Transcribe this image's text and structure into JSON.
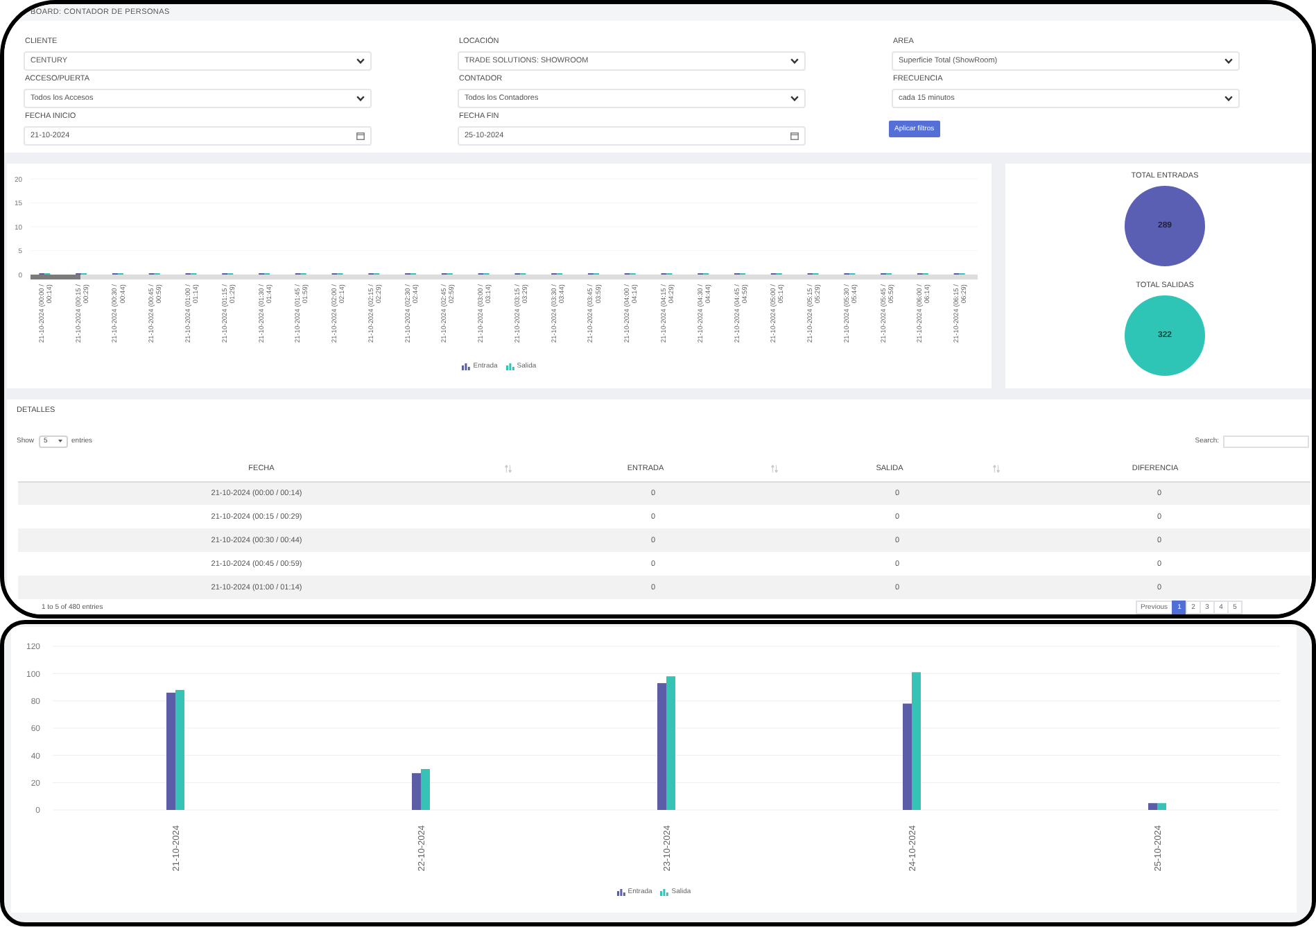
{
  "header": {
    "title": "BOARD: CONTADOR DE PERSONAS"
  },
  "filters": [
    {
      "label": "CLIENTE",
      "value": "CENTURY",
      "kind": "select"
    },
    {
      "label": "LOCACIÓN",
      "value": "TRADE SOLUTIONS: SHOWROOM",
      "kind": "select"
    },
    {
      "label": "AREA",
      "value": "Superficie Total (ShowRoom)",
      "kind": "select"
    },
    {
      "label": "ACCESO/PUERTA",
      "value": "Todos los Accesos",
      "kind": "select"
    },
    {
      "label": "CONTADOR",
      "value": "Todos los Contadores",
      "kind": "select"
    },
    {
      "label": "FRECUENCIA",
      "value": "cada 15 minutos",
      "kind": "select"
    },
    {
      "label": "FECHA INICIO",
      "value": "21-10-2024",
      "kind": "date"
    },
    {
      "label": "FECHA FIN",
      "value": "25-10-2024",
      "kind": "date"
    }
  ],
  "apply_button": "Aplicar filtros",
  "interval_chart": {
    "chart_data": {
      "type": "bar",
      "categories": [
        "21-10-2024 (00:00 / 00:14)",
        "21-10-2024 (00:15 / 00:29)",
        "21-10-2024 (00:30 / 00:44)",
        "21-10-2024 (00:45 / 00:59)",
        "21-10-2024 (01:00 / 01:14)",
        "21-10-2024 (01:15 / 01:29)",
        "21-10-2024 (01:30 / 01:44)",
        "21-10-2024 (01:45 / 01:59)",
        "21-10-2024 (02:00 / 02:14)",
        "21-10-2024 (02:15 / 02:29)",
        "21-10-2024 (02:30 / 02:44)",
        "21-10-2024 (02:45 / 02:59)",
        "21-10-2024 (03:00 / 03:14)",
        "21-10-2024 (03:15 / 03:29)",
        "21-10-2024 (03:30 / 03:44)",
        "21-10-2024 (03:45 / 03:59)",
        "21-10-2024 (04:00 / 04:14)",
        "21-10-2024 (04:15 / 04:29)",
        "21-10-2024 (04:30 / 04:44)",
        "21-10-2024 (04:45 / 04:59)",
        "21-10-2024 (05:00 / 05:14)",
        "21-10-2024 (05:15 / 05:29)",
        "21-10-2024 (05:30 / 05:44)",
        "21-10-2024 (05:45 / 05:59)",
        "21-10-2024 (06:00 / 06:14)",
        "21-10-2024 (06:15 / 06:29)"
      ],
      "series": [
        {
          "name": "Entrada",
          "color": "#5b5ea6",
          "values": [
            0,
            0,
            0,
            0,
            0,
            0,
            0,
            0,
            0,
            0,
            0,
            0,
            0,
            0,
            0,
            0,
            0,
            0,
            0,
            0,
            0,
            0,
            0,
            0,
            0,
            0
          ]
        },
        {
          "name": "Salida",
          "color": "#2ec4b6",
          "values": [
            0,
            0,
            0,
            0,
            0,
            0,
            0,
            0,
            0,
            0,
            0,
            0,
            0,
            0,
            0,
            0,
            0,
            0,
            0,
            0,
            0,
            0,
            0,
            0,
            0,
            0
          ]
        }
      ],
      "ylim": [
        0,
        20
      ],
      "yticks": [
        0,
        5,
        10,
        15,
        20
      ],
      "grid": true
    }
  },
  "totals": [
    {
      "label": "TOTAL ENTRADAS",
      "value": "289",
      "color": "#5b5fb4"
    },
    {
      "label": "TOTAL SALIDAS",
      "value": "322",
      "color": "#2ec4b6"
    }
  ],
  "details": {
    "title": "DETALLES",
    "show_label": "Show",
    "page_size": "5",
    "entries_label": "entries",
    "search_label": "Search:",
    "columns": [
      {
        "label": "FECHA",
        "sort_icon": true
      },
      {
        "label": "ENTRADA",
        "sort_icon": true
      },
      {
        "label": "SALIDA",
        "sort_icon": true
      },
      {
        "label": "DIFERENCIA",
        "sort_icon": false
      }
    ],
    "rows": [
      [
        "21-10-2024 (00:00 / 00:14)",
        "0",
        "0",
        "0"
      ],
      [
        "21-10-2024 (00:15 / 00:29)",
        "0",
        "0",
        "0"
      ],
      [
        "21-10-2024 (00:30 / 00:44)",
        "0",
        "0",
        "0"
      ],
      [
        "21-10-2024 (00:45 / 00:59)",
        "0",
        "0",
        "0"
      ],
      [
        "21-10-2024 (01:00 / 01:14)",
        "0",
        "0",
        "0"
      ]
    ],
    "info": "1 to 5 of 480 entries",
    "pagination": [
      {
        "label": "Previous",
        "selected": false
      },
      {
        "label": "1",
        "selected": true
      },
      {
        "label": "2",
        "selected": false
      },
      {
        "label": "3",
        "selected": false
      },
      {
        "label": "4",
        "selected": false
      },
      {
        "label": "5",
        "selected": false
      }
    ]
  },
  "daily_chart": {
    "chart_data": {
      "type": "bar",
      "categories": [
        "21-10-2024",
        "22-10-2024",
        "23-10-2024",
        "24-10-2024",
        "25-10-2024"
      ],
      "series": [
        {
          "name": "Entrada",
          "color": "#5b5ea6",
          "values": [
            86,
            27,
            93,
            78,
            5
          ]
        },
        {
          "name": "Salida",
          "color": "#36c2b4",
          "values": [
            88,
            30,
            98,
            101,
            5
          ]
        }
      ],
      "ylim": [
        0,
        120
      ],
      "yticks": [
        0,
        20,
        40,
        60,
        80,
        100,
        120
      ],
      "grid": true
    }
  }
}
